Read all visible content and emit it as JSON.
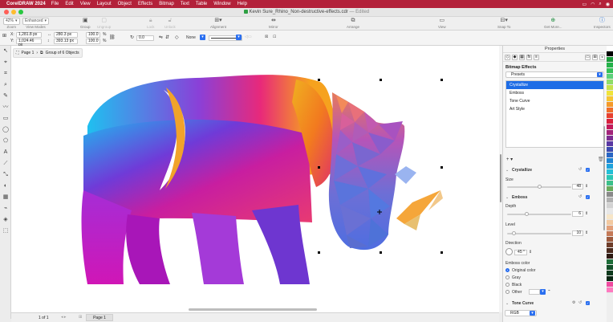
{
  "menubar": {
    "app_name": "CorelDRAW 2024",
    "items": [
      "File",
      "Edit",
      "View",
      "Layout",
      "Object",
      "Effects",
      "Bitmap",
      "Text",
      "Table",
      "Window",
      "Help"
    ]
  },
  "titlebar": {
    "title": "Kevin Sure_Rhino_Non-destructive-effects.cdr",
    "status": "— Edited"
  },
  "toolbar": {
    "zoom_value": "42%",
    "view_mode_value": "Enhanced",
    "zoom_label": "Zoom",
    "view_modes_label": "View Modes",
    "group_label": "Group",
    "ungroup_label": "Ungroup",
    "lock_label": "Lock",
    "unlock_label": "Unlock",
    "alignment_label": "Alignment",
    "mirror_label": "Mirror",
    "arrange_label": "Arrange",
    "view_label": "View",
    "snap_to_label": "Snap To",
    "get_more_label": "Get More...",
    "inspectors_label": "Inspectors"
  },
  "propbar": {
    "x": "1,281.8 px",
    "y": "1,024.46 px",
    "w": "280.3 px",
    "h": "393.13 px",
    "scale_w": "100.0",
    "scale_h": "100.0",
    "pct": "%",
    "angle": "0.0",
    "outline": "None"
  },
  "doc_tabs": {
    "page": "Page 1",
    "object": "Group of 6 Objects"
  },
  "statusbar": {
    "page_count": "1  of  1",
    "page_tab": "Page 1"
  },
  "docker": {
    "header": "Properties",
    "section_title": "Bitmap Effects",
    "presets": "Presets",
    "effects": [
      "Crystallize",
      "Emboss",
      "Tone Curve",
      "Art Style"
    ],
    "selected_effect": "Crystallize",
    "crystallize": {
      "name": "Crystallize",
      "size_label": "Size",
      "size_value": "48"
    },
    "emboss": {
      "name": "Emboss",
      "depth_label": "Depth",
      "depth_value": "6",
      "level_label": "Level",
      "level_value": "10",
      "direction_label": "Direction",
      "direction_value": "45 °",
      "color_label": "Emboss color",
      "color_options": [
        "Original color",
        "Gray",
        "Black",
        "Other"
      ],
      "selected_color": "Original color"
    },
    "tone_curve": {
      "name": "Tone Curve",
      "channel": "RGB"
    }
  },
  "colors": {
    "menubar": "#b3213a",
    "accent": "#2a6ff0",
    "selection": "#1e6de6"
  },
  "palette": [
    "#ffffff",
    "#000000",
    "#1a9a3a",
    "#24b24a",
    "#36c157",
    "#5cd17a",
    "#8fdd6a",
    "#c6e24d",
    "#f0e43a",
    "#f7c531",
    "#f59a2a",
    "#ef6e2a",
    "#e8412f",
    "#d8213d",
    "#c21a5a",
    "#a3247a",
    "#7c2d91",
    "#5a37a3",
    "#3c4bb0",
    "#2a66c4",
    "#1f84d4",
    "#1ea3dc",
    "#24bfd7",
    "#2ac7b4",
    "#3cc08a",
    "#6aaa5c",
    "#8a8a8a",
    "#b0b0b0",
    "#d2d2d2",
    "#e8e8e8",
    "#f7e6c8",
    "#f3c9a0",
    "#e3a07a",
    "#c57a58",
    "#9d5a3e",
    "#6e3d2a",
    "#4a2a1e",
    "#2e1a12",
    "#1f6e3a",
    "#14502a",
    "#0e3a1e",
    "#0a2614",
    "#f04aa0",
    "#ff7ac0"
  ]
}
